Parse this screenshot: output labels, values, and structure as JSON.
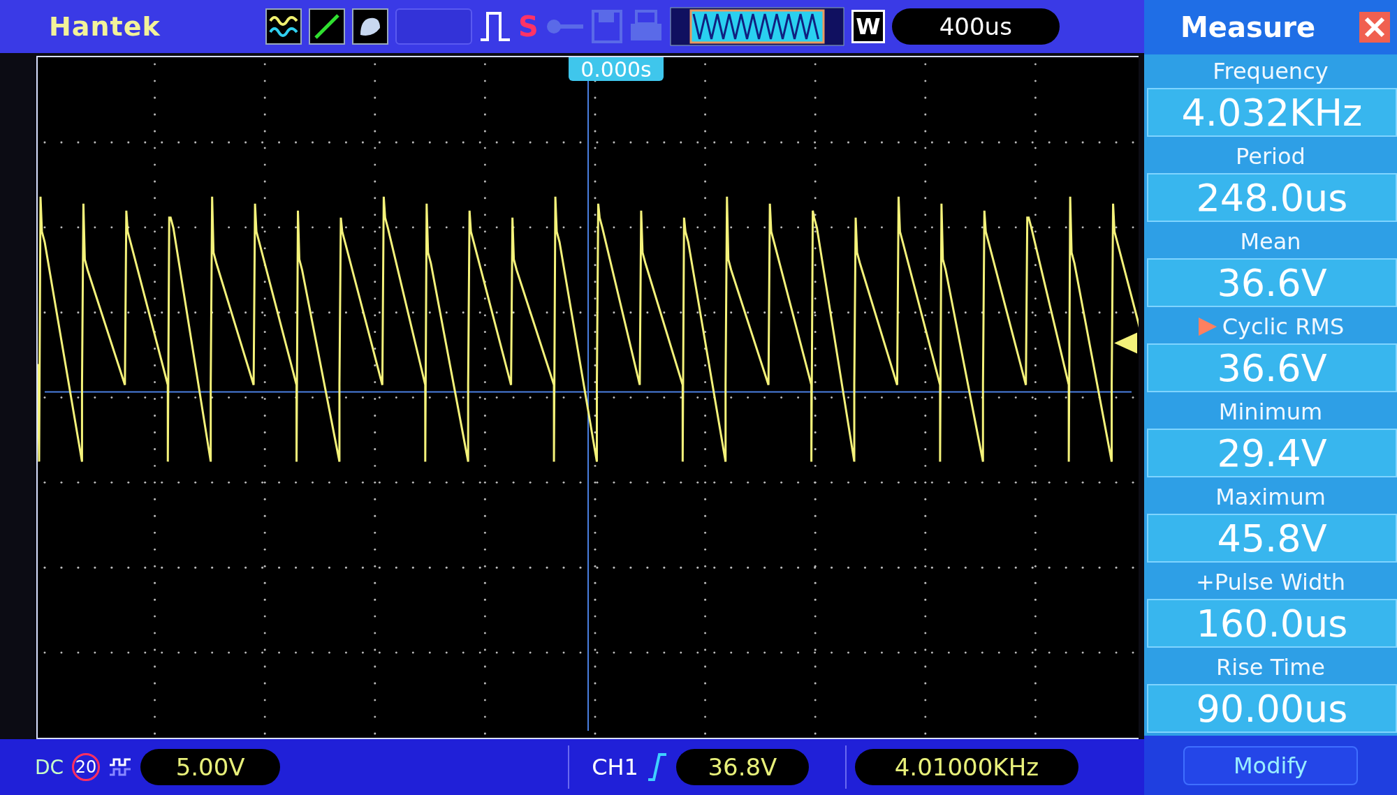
{
  "top_bar": {
    "brand": "Hantek",
    "run_status": "S",
    "zoom_key": "W",
    "timebase": "400us"
  },
  "plot": {
    "trigger_position": "0.000s"
  },
  "measure_panel": {
    "title": "Measure",
    "measurements": [
      {
        "label": "Frequency",
        "value": "4.032KHz",
        "selected": false
      },
      {
        "label": "Period",
        "value": "248.0us",
        "selected": false
      },
      {
        "label": "Mean",
        "value": "36.6V",
        "selected": false
      },
      {
        "label": "Cyclic RMS",
        "value": "36.6V",
        "selected": true
      },
      {
        "label": "Minimum",
        "value": "29.4V",
        "selected": false
      },
      {
        "label": "Maximum",
        "value": "45.8V",
        "selected": false
      },
      {
        "label": "+Pulse Width",
        "value": "160.0us",
        "selected": false
      },
      {
        "label": "Rise Time",
        "value": "90.00us",
        "selected": false
      }
    ],
    "button": "Modify"
  },
  "bottom_bar": {
    "coupling": "DC",
    "bandwidth_limit": "20",
    "volts_per_div": "5.00V",
    "trigger_source": "CH1",
    "trigger_level": "36.8V",
    "trigger_frequency": "4.01000KHz"
  }
}
